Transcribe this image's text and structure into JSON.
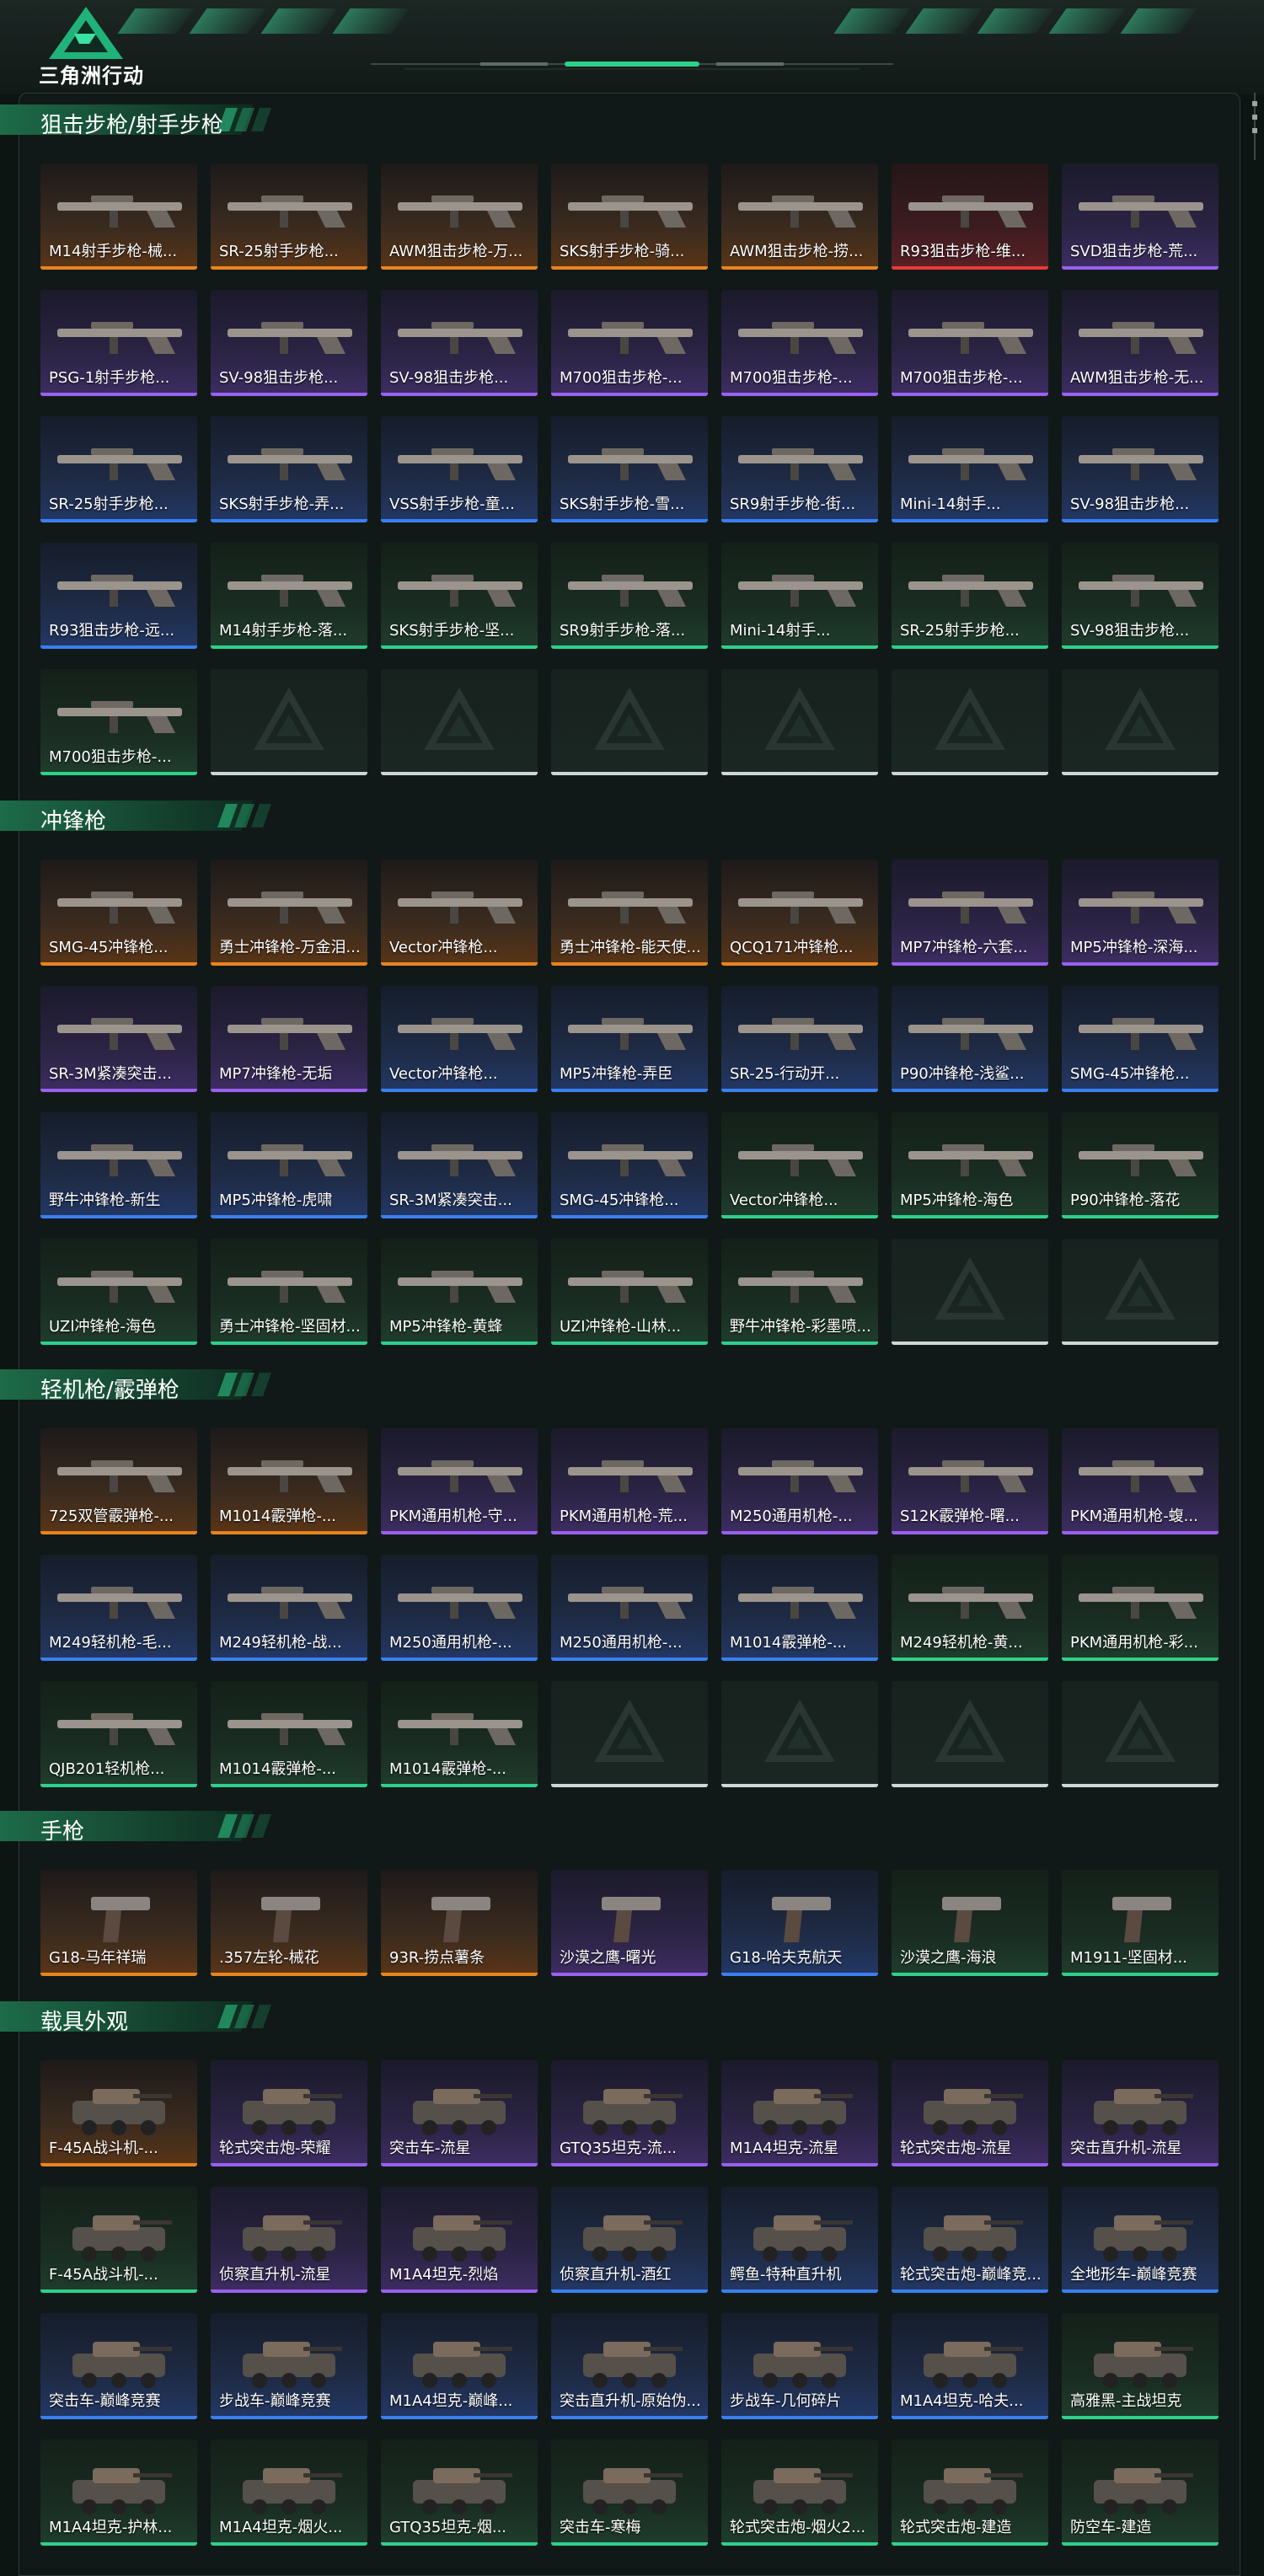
{
  "app": {
    "logo_text": "三角洲行动"
  },
  "colors": {
    "orange": "#e8841e",
    "red": "#e83a3a",
    "purple": "#9a60f0",
    "blue": "#3a7ff0",
    "green": "#2fd08a",
    "empty": "#cfd6d3"
  },
  "sections": [
    {
      "title": "狙击步枪/射手步枪",
      "items": [
        {
          "label": "M14射手步枪-械...",
          "quality": "orange"
        },
        {
          "label": "SR-25射手步枪...",
          "quality": "orange"
        },
        {
          "label": "AWM狙击步枪-万...",
          "quality": "orange"
        },
        {
          "label": "SKS射手步枪-骑...",
          "quality": "orange"
        },
        {
          "label": "AWM狙击步枪-捞...",
          "quality": "orange"
        },
        {
          "label": "R93狙击步枪-维...",
          "quality": "red"
        },
        {
          "label": "SVD狙击步枪-荒...",
          "quality": "purple"
        },
        {
          "label": "PSG-1射手步枪...",
          "quality": "purple"
        },
        {
          "label": "SV-98狙击步枪...",
          "quality": "purple"
        },
        {
          "label": "SV-98狙击步枪...",
          "quality": "purple"
        },
        {
          "label": "M700狙击步枪-...",
          "quality": "purple"
        },
        {
          "label": "M700狙击步枪-...",
          "quality": "purple"
        },
        {
          "label": "M700狙击步枪-...",
          "quality": "purple"
        },
        {
          "label": "AWM狙击步枪-无...",
          "quality": "purple"
        },
        {
          "label": "SR-25射手步枪...",
          "quality": "blue"
        },
        {
          "label": "SKS射手步枪-弄...",
          "quality": "blue"
        },
        {
          "label": "VSS射手步枪-童...",
          "quality": "blue"
        },
        {
          "label": "SKS射手步枪-雪...",
          "quality": "blue"
        },
        {
          "label": "SR9射手步枪-街...",
          "quality": "blue"
        },
        {
          "label": "Mini-14射手...",
          "quality": "blue"
        },
        {
          "label": "SV-98狙击步枪...",
          "quality": "blue"
        },
        {
          "label": "R93狙击步枪-远...",
          "quality": "blue"
        },
        {
          "label": "M14射手步枪-落...",
          "quality": "green"
        },
        {
          "label": "SKS射手步枪-坚...",
          "quality": "green"
        },
        {
          "label": "SR9射手步枪-落...",
          "quality": "green"
        },
        {
          "label": "Mini-14射手...",
          "quality": "green"
        },
        {
          "label": "SR-25射手步枪...",
          "quality": "green"
        },
        {
          "label": "SV-98狙击步枪...",
          "quality": "green"
        },
        {
          "label": "M700狙击步枪-...",
          "quality": "green"
        },
        {
          "label": "",
          "quality": "empty"
        },
        {
          "label": "",
          "quality": "empty"
        },
        {
          "label": "",
          "quality": "empty"
        },
        {
          "label": "",
          "quality": "empty"
        },
        {
          "label": "",
          "quality": "empty"
        },
        {
          "label": "",
          "quality": "empty"
        }
      ]
    },
    {
      "title": "冲锋枪",
      "items": [
        {
          "label": "SMG-45冲锋枪...",
          "quality": "orange"
        },
        {
          "label": "勇士冲锋枪-万金泪...",
          "quality": "orange"
        },
        {
          "label": "Vector冲锋枪...",
          "quality": "orange"
        },
        {
          "label": "勇士冲锋枪-能天使...",
          "quality": "orange"
        },
        {
          "label": "QCQ171冲锋枪...",
          "quality": "orange"
        },
        {
          "label": "MP7冲锋枪-六套...",
          "quality": "purple"
        },
        {
          "label": "MP5冲锋枪-深海...",
          "quality": "purple"
        },
        {
          "label": "SR-3M紧凑突击...",
          "quality": "purple"
        },
        {
          "label": "MP7冲锋枪-无垢",
          "quality": "purple"
        },
        {
          "label": "Vector冲锋枪...",
          "quality": "blue"
        },
        {
          "label": "MP5冲锋枪-弄臣",
          "quality": "blue"
        },
        {
          "label": "SR-25-行动开...",
          "quality": "blue"
        },
        {
          "label": "P90冲锋枪-浅鲨...",
          "quality": "blue"
        },
        {
          "label": "SMG-45冲锋枪...",
          "quality": "blue"
        },
        {
          "label": "野牛冲锋枪-新生",
          "quality": "blue"
        },
        {
          "label": "MP5冲锋枪-虎啸",
          "quality": "blue"
        },
        {
          "label": "SR-3M紧凑突击...",
          "quality": "blue"
        },
        {
          "label": "SMG-45冲锋枪...",
          "quality": "blue"
        },
        {
          "label": "Vector冲锋枪...",
          "quality": "green"
        },
        {
          "label": "MP5冲锋枪-海色",
          "quality": "green"
        },
        {
          "label": "P90冲锋枪-落花",
          "quality": "green"
        },
        {
          "label": "UZI冲锋枪-海色",
          "quality": "green"
        },
        {
          "label": "勇士冲锋枪-坚固材...",
          "quality": "green"
        },
        {
          "label": "MP5冲锋枪-黄蜂",
          "quality": "green"
        },
        {
          "label": "UZI冲锋枪-山林...",
          "quality": "green"
        },
        {
          "label": "野牛冲锋枪-彩墨喷...",
          "quality": "green"
        },
        {
          "label": "",
          "quality": "empty"
        },
        {
          "label": "",
          "quality": "empty"
        }
      ]
    },
    {
      "title": "轻机枪/霰弹枪",
      "items": [
        {
          "label": "725双管霰弹枪-...",
          "quality": "orange"
        },
        {
          "label": "M1014霰弹枪-...",
          "quality": "orange"
        },
        {
          "label": "PKM通用机枪-守...",
          "quality": "purple"
        },
        {
          "label": "PKM通用机枪-荒...",
          "quality": "purple"
        },
        {
          "label": "M250通用机枪-...",
          "quality": "purple"
        },
        {
          "label": "S12K霰弹枪-曙...",
          "quality": "purple"
        },
        {
          "label": "PKM通用机枪-蝮...",
          "quality": "purple"
        },
        {
          "label": "M249轻机枪-毛...",
          "quality": "blue"
        },
        {
          "label": "M249轻机枪-战...",
          "quality": "blue"
        },
        {
          "label": "M250通用机枪-...",
          "quality": "blue"
        },
        {
          "label": "M250通用机枪-...",
          "quality": "blue"
        },
        {
          "label": "M1014霰弹枪-...",
          "quality": "blue"
        },
        {
          "label": "M249轻机枪-黄...",
          "quality": "green"
        },
        {
          "label": "PKM通用机枪-彩...",
          "quality": "green"
        },
        {
          "label": "QJB201轻机枪...",
          "quality": "green"
        },
        {
          "label": "M1014霰弹枪-...",
          "quality": "green"
        },
        {
          "label": "M1014霰弹枪-...",
          "quality": "green"
        },
        {
          "label": "",
          "quality": "empty"
        },
        {
          "label": "",
          "quality": "empty"
        },
        {
          "label": "",
          "quality": "empty"
        },
        {
          "label": "",
          "quality": "empty"
        }
      ]
    },
    {
      "title": "手枪",
      "items": [
        {
          "label": "G18-马年祥瑞",
          "quality": "orange"
        },
        {
          "label": ".357左轮-械花",
          "quality": "orange"
        },
        {
          "label": "93R-捞点薯条",
          "quality": "orange"
        },
        {
          "label": "沙漠之鹰-曙光",
          "quality": "purple"
        },
        {
          "label": "G18-哈夫克航天",
          "quality": "blue"
        },
        {
          "label": "沙漠之鹰-海浪",
          "quality": "green"
        },
        {
          "label": "M1911-坚固材...",
          "quality": "green"
        }
      ]
    },
    {
      "title": "载具外观",
      "items": [
        {
          "label": "F-45A战斗机-...",
          "quality": "orange"
        },
        {
          "label": "轮式突击炮-荣耀",
          "quality": "purple"
        },
        {
          "label": "突击车-流星",
          "quality": "purple"
        },
        {
          "label": "GTQ35坦克-流...",
          "quality": "purple"
        },
        {
          "label": "M1A4坦克-流星",
          "quality": "purple"
        },
        {
          "label": "轮式突击炮-流星",
          "quality": "purple"
        },
        {
          "label": "突击直升机-流星",
          "quality": "purple"
        },
        {
          "label": "F-45A战斗机-...",
          "quality": "green"
        },
        {
          "label": "侦察直升机-流星",
          "quality": "purple"
        },
        {
          "label": "M1A4坦克-烈焰",
          "quality": "purple"
        },
        {
          "label": "侦察直升机-酒红",
          "quality": "blue"
        },
        {
          "label": "鳄鱼-特种直升机",
          "quality": "blue"
        },
        {
          "label": "轮式突击炮-巅峰竞...",
          "quality": "blue"
        },
        {
          "label": "全地形车-巅峰竞赛",
          "quality": "blue"
        },
        {
          "label": "突击车-巅峰竞赛",
          "quality": "blue"
        },
        {
          "label": "步战车-巅峰竞赛",
          "quality": "blue"
        },
        {
          "label": "M1A4坦克-巅峰...",
          "quality": "blue"
        },
        {
          "label": "突击直升机-原始伪...",
          "quality": "blue"
        },
        {
          "label": "步战车-几何碎片",
          "quality": "blue"
        },
        {
          "label": "M1A4坦克-哈夫...",
          "quality": "blue"
        },
        {
          "label": "高雅黑-主战坦克",
          "quality": "green"
        },
        {
          "label": "M1A4坦克-护林...",
          "quality": "green"
        },
        {
          "label": "M1A4坦克-烟火...",
          "quality": "green"
        },
        {
          "label": "GTQ35坦克-烟...",
          "quality": "green"
        },
        {
          "label": "突击车-寒梅",
          "quality": "green"
        },
        {
          "label": "轮式突击炮-烟火2...",
          "quality": "green"
        },
        {
          "label": "轮式突击炮-建造",
          "quality": "green"
        },
        {
          "label": "防空车-建造",
          "quality": "green"
        }
      ]
    }
  ]
}
